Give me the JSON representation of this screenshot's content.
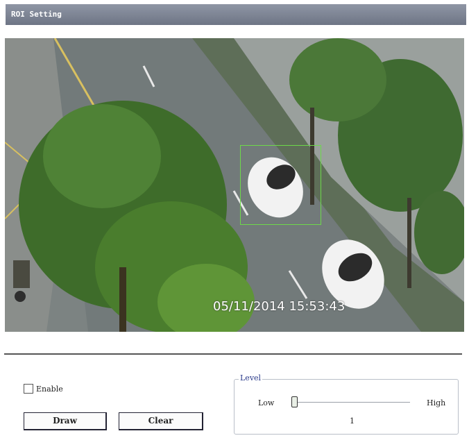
{
  "window": {
    "title": "ROI Setting"
  },
  "video": {
    "timestamp": "05/11/2014 15:53:43",
    "roi_color": "#6dd94a"
  },
  "controls": {
    "enable_label": "Enable",
    "enable_checked": false,
    "draw_label": "Draw",
    "clear_label": "Clear"
  },
  "level": {
    "legend": "Level",
    "low_label": "Low",
    "high_label": "High",
    "value": "1"
  },
  "icons": [
    "checkbox",
    "slider-thumb"
  ]
}
